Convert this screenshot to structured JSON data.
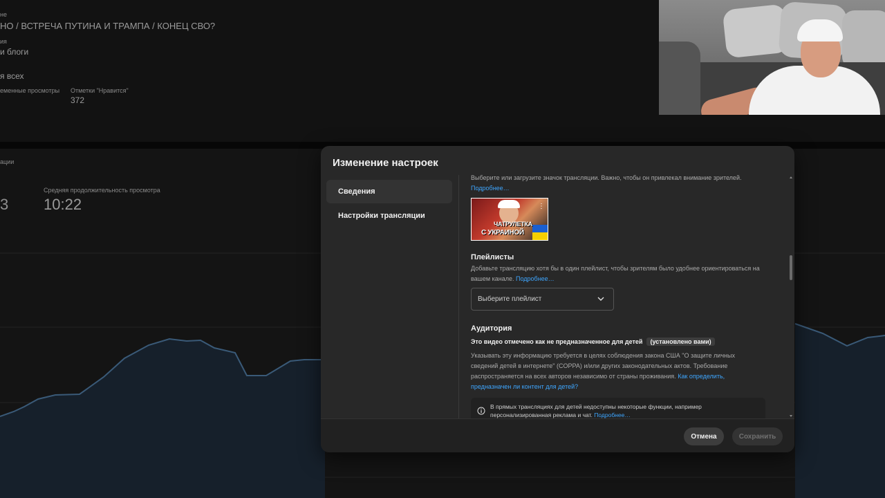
{
  "background": {
    "partial_label_1": "не",
    "video_title": "НО / ВСТРЕЧА ПУТИНА И ТРАМПА / КОНЕЦ СВО?",
    "partial_label_2": "ия",
    "category": "и блоги",
    "visibility": "я всех",
    "concurrent_views_label": "еменные просмотры",
    "likes_label": "Отметки \"Нравится\"",
    "likes_value": "372",
    "analytics_label": "ации",
    "left_metric_partial": "3",
    "avg_watch_label": "Средняя продолжительность просмотра",
    "avg_watch_value": "10:22"
  },
  "modal": {
    "title": "Изменение настроек",
    "nav": [
      {
        "label": "Сведения",
        "active": true
      },
      {
        "label": "Настройки трансляции",
        "active": false
      }
    ],
    "thumbnail": {
      "description": "Выберите или загрузите значок трансляции. Важно, чтобы он привлекал внимание зрителей.",
      "more_link": "Подробнее…",
      "image_text_line1": "ЧАТРУЛЕТКА",
      "image_text_line2": "С УКРАИНОЙ"
    },
    "playlists": {
      "heading": "Плейлисты",
      "description": "Добавьте трансляцию хотя бы в один плейлист, чтобы зрителям было удобнее ориентироваться на вашем канале.",
      "more_link": "Подробнее…",
      "select_placeholder": "Выберите плейлист"
    },
    "audience": {
      "heading": "Аудитория",
      "status": "Это видео отмечено как не предназначенное для детей",
      "status_badge": "(установлено вами)",
      "description": "Указывать эту информацию требуется в целях соблюдения закона США \"О защите личных сведений детей в интернете\" (COPPA) и/или других законодательных актов. Требование распространяется на всех авторов независимо от страны проживания.",
      "help_link": "Как определить, предназначен ли контент для детей?",
      "notice": "В прямых трансляциях для детей недоступны некоторые функции, например персонализированная реклама и чат.",
      "notice_link": "Подробнее…"
    },
    "footer": {
      "cancel_label": "Отмена",
      "save_label": "Сохранить"
    }
  },
  "colors": {
    "accent_link": "#3ea6ff",
    "modal_bg": "#282828",
    "page_bg": "#0f0f0f"
  }
}
